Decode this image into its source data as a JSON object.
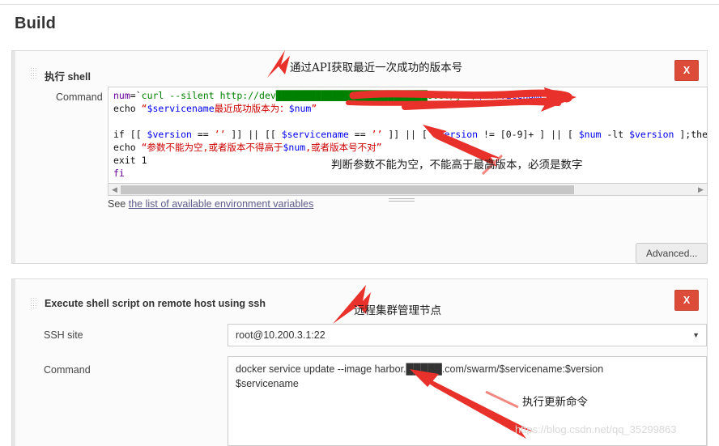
{
  "page": {
    "title": "Build",
    "watermark": "https://blog.csdn.net/qq_35299863"
  },
  "sections": [
    {
      "header": "执行 shell",
      "close_label": "X",
      "command_label": "Command",
      "env_link_prefix": "See ",
      "env_link_text": "the list of available environment variables",
      "advanced_label": "Advanced...",
      "code_lines": [
        [
          {
            "t": "num",
            "c": "kw"
          },
          {
            "t": "=",
            "c": "plain"
          },
          {
            "t": "`",
            "c": "plain"
          },
          {
            "t": "curl --silent http://dev",
            "c": "cmd"
          },
          {
            "t": "███████████████████████████",
            "c": "cmd"
          },
          {
            "t": "8080/job/",
            "c": "cmd"
          },
          {
            "t": "$servicename",
            "c": "var"
          },
          {
            "t": "/l",
            "c": "cmd"
          }
        ],
        [
          {
            "t": "echo ",
            "c": "plain"
          },
          {
            "t": "“",
            "c": "str"
          },
          {
            "t": "$servicename",
            "c": "var"
          },
          {
            "t": "最近成功版本为：",
            "c": "str"
          },
          {
            "t": "$num",
            "c": "var"
          },
          {
            "t": "”",
            "c": "str"
          }
        ],
        [],
        [
          {
            "t": "if [[ ",
            "c": "plain"
          },
          {
            "t": "$version",
            "c": "var"
          },
          {
            "t": " == ",
            "c": "plain"
          },
          {
            "t": "’’",
            "c": "str"
          },
          {
            "t": " ]] || [[ ",
            "c": "plain"
          },
          {
            "t": "$servicename",
            "c": "var"
          },
          {
            "t": " == ",
            "c": "plain"
          },
          {
            "t": "’’",
            "c": "str"
          },
          {
            "t": " ]] || [ ",
            "c": "plain"
          },
          {
            "t": "$version",
            "c": "var"
          },
          {
            "t": " != [0-9]+ ] || [ ",
            "c": "plain"
          },
          {
            "t": "$num",
            "c": "var"
          },
          {
            "t": " -lt ",
            "c": "plain"
          },
          {
            "t": "$version",
            "c": "var"
          },
          {
            "t": " ];the",
            "c": "plain"
          }
        ],
        [
          {
            "t": "echo ",
            "c": "plain"
          },
          {
            "t": "“参数不能为空,或者版本不得高于",
            "c": "str"
          },
          {
            "t": "$num",
            "c": "var"
          },
          {
            "t": ",或者版本号不对”",
            "c": "str"
          }
        ],
        [
          {
            "t": "exit 1",
            "c": "plain"
          }
        ],
        [
          {
            "t": "fi",
            "c": "kw"
          }
        ]
      ]
    },
    {
      "header": "Execute shell script on remote host using ssh",
      "close_label": "X",
      "ssh_site_label": "SSH site",
      "ssh_site_value": "root@10.200.3.1:22",
      "command_label": "Command",
      "command_value": "docker service update --image harbor.█████.com/swarm/$servicename:$version\n$servicename"
    }
  ],
  "annotations": [
    {
      "id": "a1",
      "text": "通过API获取最近一次成功的版本号"
    },
    {
      "id": "a2",
      "text": "判断参数不能为空，不能高于最高版本，必须是数字"
    },
    {
      "id": "a3",
      "text": "远程集群管理节点"
    },
    {
      "id": "a4",
      "text": "执行更新命令"
    }
  ],
  "colors": {
    "accent_red": "#e2231a",
    "danger": "#dd4b39",
    "link": "#5c5c8a"
  }
}
